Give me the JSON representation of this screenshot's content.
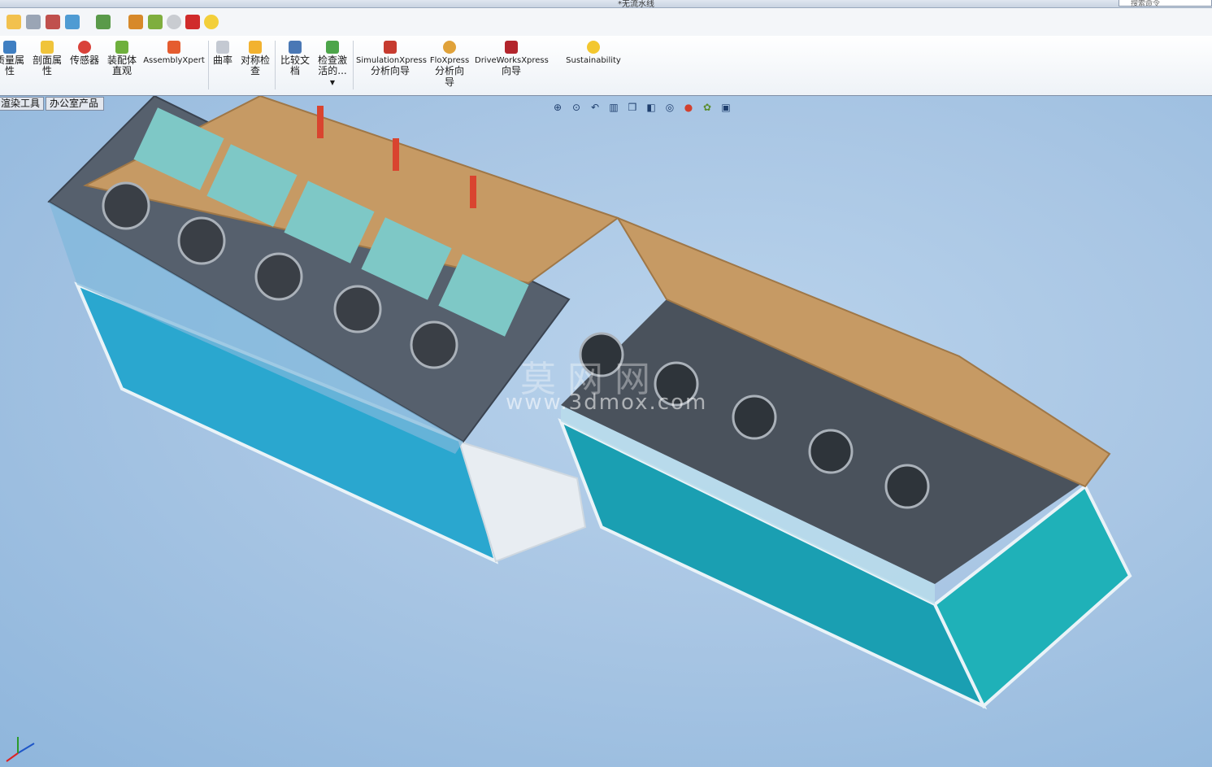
{
  "window": {
    "title": "*无流水线",
    "search_placeholder": "搜索命令"
  },
  "quick_access": {
    "icons": [
      "open-icon",
      "rebuild-icon",
      "options-icon",
      "pointer-icon",
      "light-icon",
      "doc-icon",
      "image-icon",
      "warning-icon",
      "arrows-icon",
      "macro-icon",
      "check-icon",
      "tool-icon",
      "measure-icon",
      "color-icon",
      "check-circle-icon",
      "red-box-icon",
      "yellow-icon"
    ]
  },
  "ribbon": {
    "items": [
      {
        "label_l1": "质量属",
        "label_l2": "性"
      },
      {
        "label_l1": "剖面属",
        "label_l2": "性"
      },
      {
        "label_l1": "传感器",
        "label_l2": ""
      },
      {
        "label_l1": "装配体",
        "label_l2": "直观"
      },
      {
        "label_l1": "AssemblyXpert",
        "label_l2": ""
      },
      {
        "label_l1": "曲率",
        "label_l2": ""
      },
      {
        "label_l1": "对称检",
        "label_l2": "查"
      },
      {
        "label_l1": "比较文",
        "label_l2": "档"
      },
      {
        "label_l1": "检查激",
        "label_l2": "活的..."
      },
      {
        "label_l1": "SimulationXpress",
        "label_l2": "分析向导"
      },
      {
        "label_l1": "FloXpress",
        "label_l2": "分析向",
        "label_l3": "导"
      },
      {
        "label_l1": "DriveWorksXpress",
        "label_l2": "向导"
      },
      {
        "label_l1": "Sustainability",
        "label_l2": ""
      }
    ]
  },
  "tabs": [
    {
      "label": "渲染工具"
    },
    {
      "label": "办公室产品"
    }
  ],
  "viewport": {
    "watermark": "www.3dmox.com",
    "watermark_logo": "莫 网 网"
  },
  "colors": {
    "accent": "#1fa6c9",
    "background": "#a9c6e4"
  }
}
